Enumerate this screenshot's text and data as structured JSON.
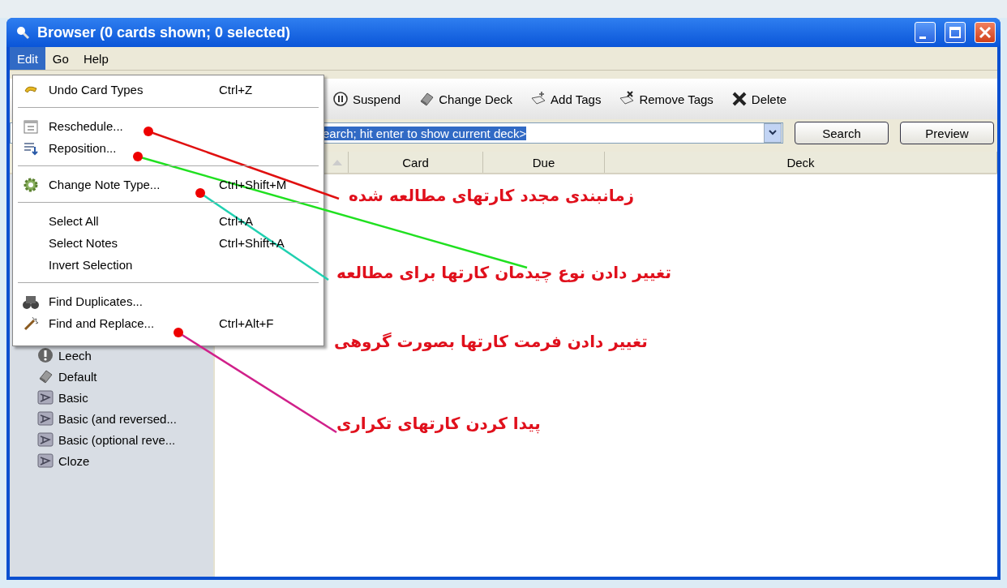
{
  "window": {
    "title": "Browser (0 cards shown; 0 selected)"
  },
  "menubar": [
    {
      "label": "Edit",
      "selected": true
    },
    {
      "label": "Go",
      "selected": false
    },
    {
      "label": "Help",
      "selected": false
    }
  ],
  "edit_menu": [
    {
      "kind": "item",
      "label": "Undo Card Types",
      "shortcut": "Ctrl+Z"
    },
    {
      "kind": "separator"
    },
    {
      "kind": "item",
      "label": "Reschedule..."
    },
    {
      "kind": "item",
      "label": "Reposition..."
    },
    {
      "kind": "separator"
    },
    {
      "kind": "item",
      "label": "Change Note Type...",
      "shortcut": "Ctrl+Shift+M"
    },
    {
      "kind": "separator"
    },
    {
      "kind": "item",
      "label": "Select All",
      "shortcut": "Ctrl+A"
    },
    {
      "kind": "item",
      "label": "Select Notes",
      "shortcut": "Ctrl+Shift+A"
    },
    {
      "kind": "item",
      "label": "Invert Selection"
    },
    {
      "kind": "separator"
    },
    {
      "kind": "item",
      "label": "Find Duplicates..."
    },
    {
      "kind": "item",
      "label": "Find and Replace...",
      "shortcut": "Ctrl+Alt+F"
    }
  ],
  "toolbar": [
    "Suspend",
    "Change Deck",
    "Add Tags",
    "Remove Tags",
    "Delete"
  ],
  "search": {
    "value": "earch; hit enter to show current deck>"
  },
  "buttons": [
    "Search",
    "Preview"
  ],
  "table": {
    "columns": [
      "Card",
      "Due",
      "Deck"
    ]
  },
  "sidebar": {
    "items": [
      "Leech",
      "Default",
      "Basic",
      "Basic (and reversed...",
      "Basic (optional reve...",
      "Cloze"
    ]
  },
  "leader_lines": [
    {
      "color": "#e01010"
    },
    {
      "color": "#20e020"
    },
    {
      "color": "#20d0b0"
    },
    {
      "color": "#d0208a"
    }
  ],
  "annotations": [
    "زمانبندی مجدد کارتهای مطالعه شده",
    "تغییر دادن نوع چیدمان کارتها برای مطالعه",
    "تغییر دادن فرمت کارتها بصورت گروهی",
    "پیدا کردن کارتهای تکراری"
  ]
}
